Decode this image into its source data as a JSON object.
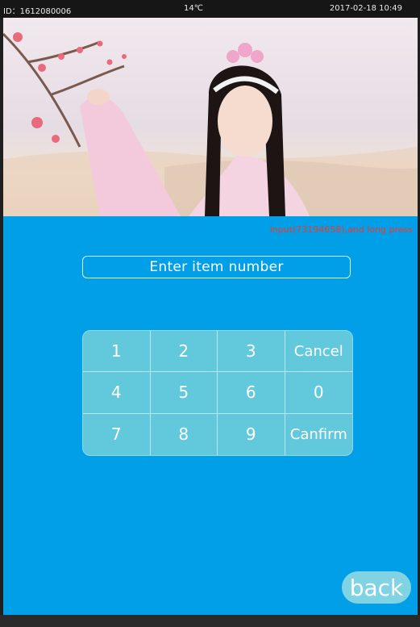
{
  "status_bar": {
    "device_id": "ID：1612080006",
    "temperature": "14℃",
    "datetime": "2017-02-18 10:49"
  },
  "banner": {
    "description_icon": "advertisement-photo"
  },
  "main": {
    "hint": "input(73194658),and long press",
    "item_input_placeholder": "Enter item number",
    "item_input_value": ""
  },
  "keypad": {
    "keys": [
      "1",
      "2",
      "3",
      "Cancel",
      "4",
      "5",
      "6",
      "0",
      "7",
      "8",
      "9",
      "Canfirm"
    ]
  },
  "back_label": "back",
  "colors": {
    "main_bg": "#009fe8",
    "keypad_bg": "#62c8dc",
    "hint": "#ee3a2a",
    "back_bg": "#7fd3e3"
  }
}
